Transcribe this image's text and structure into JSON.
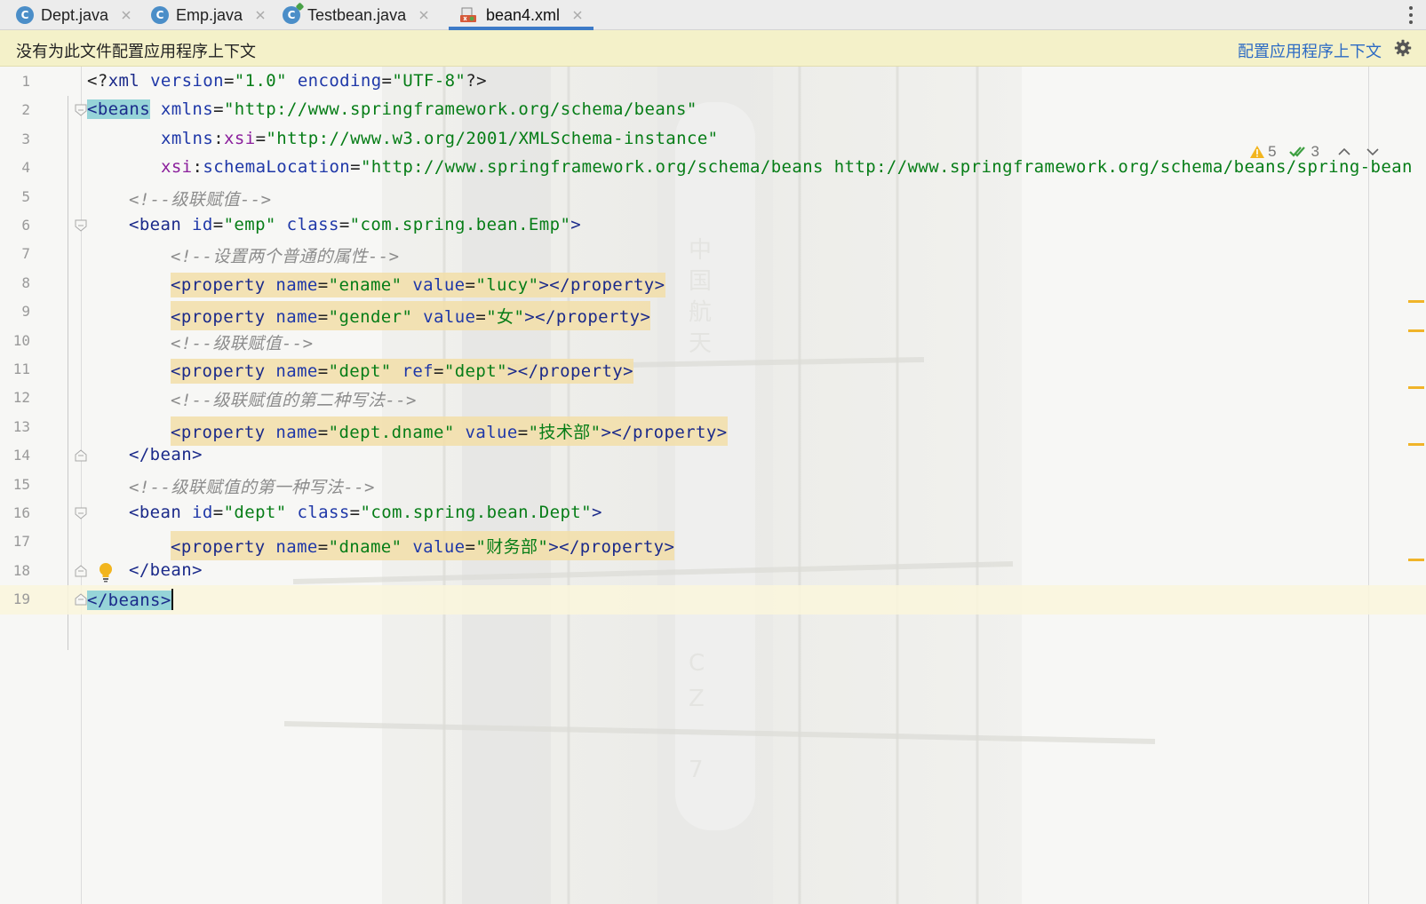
{
  "tabs": [
    {
      "label": "Dept.java",
      "icon": "java-class-icon",
      "active": false
    },
    {
      "label": "Emp.java",
      "icon": "java-class-icon",
      "active": false
    },
    {
      "label": "Testbean.java",
      "icon": "java-runnable-class-icon",
      "active": false
    },
    {
      "label": "bean4.xml",
      "icon": "xml-file-icon",
      "active": true
    }
  ],
  "banner": {
    "message": "没有为此文件配置应用程序上下文",
    "action_label": "配置应用程序上下文",
    "settings_icon": "gear-icon"
  },
  "inspections": {
    "warnings": "5",
    "weak_warnings": "3"
  },
  "colors": {
    "tag": "#1b2a8a",
    "attribute": "#1f38a8",
    "value": "#067d17",
    "comment": "#8c8c8c",
    "banner_bg": "#f4f1c9",
    "link": "#2d6bc4",
    "active_tab_underline": "#3d7ac7",
    "property_highlight": "#f2dea8"
  },
  "editor": {
    "lines": [
      {
        "n": "1",
        "tokens": [
          [
            "punc",
            "<?"
          ],
          [
            "tag",
            "xml"
          ],
          [
            "punc",
            " "
          ],
          [
            "attr",
            "version"
          ],
          [
            "punc",
            "="
          ],
          [
            "val",
            "\"1.0\""
          ],
          [
            "punc",
            " "
          ],
          [
            "attr",
            "encoding"
          ],
          [
            "punc",
            "="
          ],
          [
            "val",
            "\"UTF-8\""
          ],
          [
            "punc",
            "?>"
          ]
        ]
      },
      {
        "n": "2",
        "tokens": [
          [
            "hltag",
            "<beans"
          ],
          [
            "punc",
            " "
          ],
          [
            "attr",
            "xmlns"
          ],
          [
            "punc",
            "="
          ],
          [
            "val",
            "\"http://www.springframework.org/schema/beans\""
          ]
        ]
      },
      {
        "n": "3",
        "tokens": [
          [
            "attr",
            "xmlns"
          ],
          [
            "punc",
            ":"
          ],
          [
            "xsi",
            "xsi"
          ],
          [
            "punc",
            "="
          ],
          [
            "val",
            "\"http://www.w3.org/2001/XMLSchema-instance\""
          ]
        ]
      },
      {
        "n": "4",
        "tokens": [
          [
            "xsi",
            "xsi"
          ],
          [
            "punc",
            ":"
          ],
          [
            "attr",
            "schemaLocation"
          ],
          [
            "punc",
            "="
          ],
          [
            "val",
            "\"http://www.springframework.org/schema/beans http://www.springframework.org/schema/beans/spring-bean"
          ]
        ]
      },
      {
        "n": "5",
        "tokens": [
          [
            "comment",
            "<!--级联赋值-->"
          ]
        ]
      },
      {
        "n": "6",
        "tokens": [
          [
            "tag",
            "<bean"
          ],
          [
            "punc",
            " "
          ],
          [
            "attr",
            "id"
          ],
          [
            "punc",
            "="
          ],
          [
            "val",
            "\"emp\""
          ],
          [
            "punc",
            " "
          ],
          [
            "attr",
            "class"
          ],
          [
            "punc",
            "="
          ],
          [
            "val",
            "\"com.spring.bean.Emp\""
          ],
          [
            "tag",
            ">"
          ]
        ]
      },
      {
        "n": "7",
        "tokens": [
          [
            "comment",
            "<!--设置两个普通的属性-->"
          ]
        ]
      },
      {
        "n": "8",
        "prop": true,
        "tokens": [
          [
            "tag",
            "<property"
          ],
          [
            "punc",
            " "
          ],
          [
            "attr",
            "name"
          ],
          [
            "punc",
            "="
          ],
          [
            "val",
            "\"ename\""
          ],
          [
            "punc",
            " "
          ],
          [
            "attr",
            "value"
          ],
          [
            "punc",
            "="
          ],
          [
            "val",
            "\"lucy\""
          ],
          [
            "tag",
            "></property>"
          ]
        ]
      },
      {
        "n": "9",
        "prop": true,
        "tokens": [
          [
            "tag",
            "<property"
          ],
          [
            "punc",
            " "
          ],
          [
            "attr",
            "name"
          ],
          [
            "punc",
            "="
          ],
          [
            "val",
            "\"gender\""
          ],
          [
            "punc",
            " "
          ],
          [
            "attr",
            "value"
          ],
          [
            "punc",
            "="
          ],
          [
            "val",
            "\"女\""
          ],
          [
            "tag",
            "></property>"
          ]
        ]
      },
      {
        "n": "10",
        "tokens": [
          [
            "comment",
            "<!--级联赋值-->"
          ]
        ]
      },
      {
        "n": "11",
        "prop": true,
        "tokens": [
          [
            "tag",
            "<property"
          ],
          [
            "punc",
            " "
          ],
          [
            "attr",
            "name"
          ],
          [
            "punc",
            "="
          ],
          [
            "val",
            "\"dept\""
          ],
          [
            "punc",
            " "
          ],
          [
            "attr",
            "ref"
          ],
          [
            "punc",
            "="
          ],
          [
            "val",
            "\"dept\""
          ],
          [
            "tag",
            "></property>"
          ]
        ]
      },
      {
        "n": "12",
        "tokens": [
          [
            "comment",
            "<!--级联赋值的第二种写法-->"
          ]
        ]
      },
      {
        "n": "13",
        "prop": true,
        "tokens": [
          [
            "tag",
            "<property"
          ],
          [
            "punc",
            " "
          ],
          [
            "attr",
            "name"
          ],
          [
            "punc",
            "="
          ],
          [
            "val",
            "\"dept.dname\""
          ],
          [
            "punc",
            " "
          ],
          [
            "attr",
            "value"
          ],
          [
            "punc",
            "="
          ],
          [
            "val",
            "\"技术部\""
          ],
          [
            "tag",
            "></property>"
          ]
        ]
      },
      {
        "n": "14",
        "tokens": [
          [
            "tag",
            "</bean>"
          ]
        ]
      },
      {
        "n": "15",
        "tokens": [
          [
            "comment",
            "<!--级联赋值的第一种写法-->"
          ]
        ]
      },
      {
        "n": "16",
        "tokens": [
          [
            "tag",
            "<bean"
          ],
          [
            "punc",
            " "
          ],
          [
            "attr",
            "id"
          ],
          [
            "punc",
            "="
          ],
          [
            "val",
            "\"dept\""
          ],
          [
            "punc",
            " "
          ],
          [
            "attr",
            "class"
          ],
          [
            "punc",
            "="
          ],
          [
            "val",
            "\"com.spring.bean.Dept\""
          ],
          [
            "tag",
            ">"
          ]
        ]
      },
      {
        "n": "17",
        "prop": true,
        "tokens": [
          [
            "tag",
            "<property"
          ],
          [
            "punc",
            " "
          ],
          [
            "attr",
            "name"
          ],
          [
            "punc",
            "="
          ],
          [
            "val",
            "\"dname\""
          ],
          [
            "punc",
            " "
          ],
          [
            "attr",
            "value"
          ],
          [
            "punc",
            "="
          ],
          [
            "val",
            "\"财务部\""
          ],
          [
            "tag",
            "></property>"
          ]
        ]
      },
      {
        "n": "18",
        "tokens": [
          [
            "tag",
            "</bean>"
          ]
        ]
      },
      {
        "n": "19",
        "current": true,
        "tokens": [
          [
            "hltag",
            "</beans>"
          ]
        ]
      }
    ]
  }
}
